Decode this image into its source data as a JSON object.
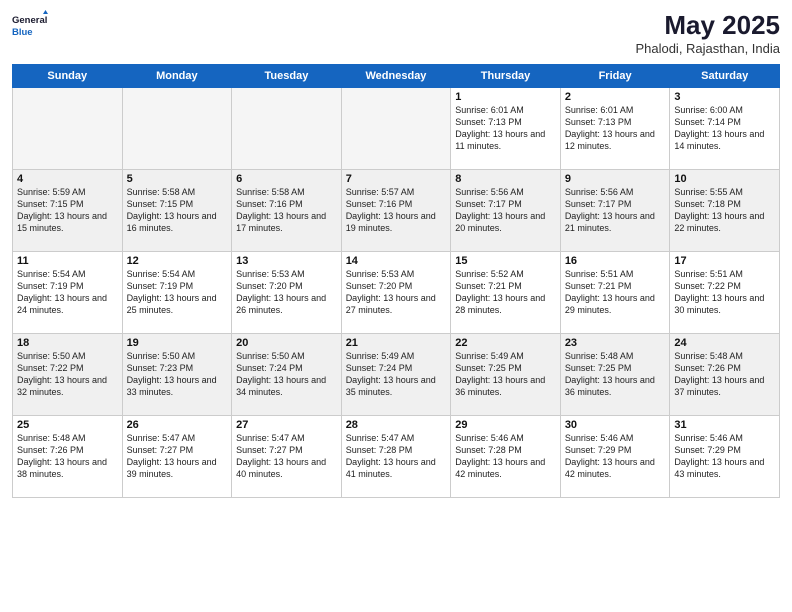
{
  "header": {
    "logo_general": "General",
    "logo_blue": "Blue",
    "title": "May 2025",
    "subtitle": "Phalodi, Rajasthan, India"
  },
  "weekdays": [
    "Sunday",
    "Monday",
    "Tuesday",
    "Wednesday",
    "Thursday",
    "Friday",
    "Saturday"
  ],
  "weeks": [
    [
      {
        "day": "",
        "empty": true
      },
      {
        "day": "",
        "empty": true
      },
      {
        "day": "",
        "empty": true
      },
      {
        "day": "",
        "empty": true
      },
      {
        "day": "1",
        "empty": false,
        "sunrise": "6:01 AM",
        "sunset": "7:13 PM",
        "daylight": "13 hours and 11 minutes."
      },
      {
        "day": "2",
        "empty": false,
        "sunrise": "6:01 AM",
        "sunset": "7:13 PM",
        "daylight": "13 hours and 12 minutes."
      },
      {
        "day": "3",
        "empty": false,
        "sunrise": "6:00 AM",
        "sunset": "7:14 PM",
        "daylight": "13 hours and 14 minutes."
      }
    ],
    [
      {
        "day": "4",
        "empty": false,
        "sunrise": "5:59 AM",
        "sunset": "7:15 PM",
        "daylight": "13 hours and 15 minutes."
      },
      {
        "day": "5",
        "empty": false,
        "sunrise": "5:58 AM",
        "sunset": "7:15 PM",
        "daylight": "13 hours and 16 minutes."
      },
      {
        "day": "6",
        "empty": false,
        "sunrise": "5:58 AM",
        "sunset": "7:16 PM",
        "daylight": "13 hours and 17 minutes."
      },
      {
        "day": "7",
        "empty": false,
        "sunrise": "5:57 AM",
        "sunset": "7:16 PM",
        "daylight": "13 hours and 19 minutes."
      },
      {
        "day": "8",
        "empty": false,
        "sunrise": "5:56 AM",
        "sunset": "7:17 PM",
        "daylight": "13 hours and 20 minutes."
      },
      {
        "day": "9",
        "empty": false,
        "sunrise": "5:56 AM",
        "sunset": "7:17 PM",
        "daylight": "13 hours and 21 minutes."
      },
      {
        "day": "10",
        "empty": false,
        "sunrise": "5:55 AM",
        "sunset": "7:18 PM",
        "daylight": "13 hours and 22 minutes."
      }
    ],
    [
      {
        "day": "11",
        "empty": false,
        "sunrise": "5:54 AM",
        "sunset": "7:19 PM",
        "daylight": "13 hours and 24 minutes."
      },
      {
        "day": "12",
        "empty": false,
        "sunrise": "5:54 AM",
        "sunset": "7:19 PM",
        "daylight": "13 hours and 25 minutes."
      },
      {
        "day": "13",
        "empty": false,
        "sunrise": "5:53 AM",
        "sunset": "7:20 PM",
        "daylight": "13 hours and 26 minutes."
      },
      {
        "day": "14",
        "empty": false,
        "sunrise": "5:53 AM",
        "sunset": "7:20 PM",
        "daylight": "13 hours and 27 minutes."
      },
      {
        "day": "15",
        "empty": false,
        "sunrise": "5:52 AM",
        "sunset": "7:21 PM",
        "daylight": "13 hours and 28 minutes."
      },
      {
        "day": "16",
        "empty": false,
        "sunrise": "5:51 AM",
        "sunset": "7:21 PM",
        "daylight": "13 hours and 29 minutes."
      },
      {
        "day": "17",
        "empty": false,
        "sunrise": "5:51 AM",
        "sunset": "7:22 PM",
        "daylight": "13 hours and 30 minutes."
      }
    ],
    [
      {
        "day": "18",
        "empty": false,
        "sunrise": "5:50 AM",
        "sunset": "7:22 PM",
        "daylight": "13 hours and 32 minutes."
      },
      {
        "day": "19",
        "empty": false,
        "sunrise": "5:50 AM",
        "sunset": "7:23 PM",
        "daylight": "13 hours and 33 minutes."
      },
      {
        "day": "20",
        "empty": false,
        "sunrise": "5:50 AM",
        "sunset": "7:24 PM",
        "daylight": "13 hours and 34 minutes."
      },
      {
        "day": "21",
        "empty": false,
        "sunrise": "5:49 AM",
        "sunset": "7:24 PM",
        "daylight": "13 hours and 35 minutes."
      },
      {
        "day": "22",
        "empty": false,
        "sunrise": "5:49 AM",
        "sunset": "7:25 PM",
        "daylight": "13 hours and 36 minutes."
      },
      {
        "day": "23",
        "empty": false,
        "sunrise": "5:48 AM",
        "sunset": "7:25 PM",
        "daylight": "13 hours and 36 minutes."
      },
      {
        "day": "24",
        "empty": false,
        "sunrise": "5:48 AM",
        "sunset": "7:26 PM",
        "daylight": "13 hours and 37 minutes."
      }
    ],
    [
      {
        "day": "25",
        "empty": false,
        "sunrise": "5:48 AM",
        "sunset": "7:26 PM",
        "daylight": "13 hours and 38 minutes."
      },
      {
        "day": "26",
        "empty": false,
        "sunrise": "5:47 AM",
        "sunset": "7:27 PM",
        "daylight": "13 hours and 39 minutes."
      },
      {
        "day": "27",
        "empty": false,
        "sunrise": "5:47 AM",
        "sunset": "7:27 PM",
        "daylight": "13 hours and 40 minutes."
      },
      {
        "day": "28",
        "empty": false,
        "sunrise": "5:47 AM",
        "sunset": "7:28 PM",
        "daylight": "13 hours and 41 minutes."
      },
      {
        "day": "29",
        "empty": false,
        "sunrise": "5:46 AM",
        "sunset": "7:28 PM",
        "daylight": "13 hours and 42 minutes."
      },
      {
        "day": "30",
        "empty": false,
        "sunrise": "5:46 AM",
        "sunset": "7:29 PM",
        "daylight": "13 hours and 42 minutes."
      },
      {
        "day": "31",
        "empty": false,
        "sunrise": "5:46 AM",
        "sunset": "7:29 PM",
        "daylight": "13 hours and 43 minutes."
      }
    ]
  ]
}
